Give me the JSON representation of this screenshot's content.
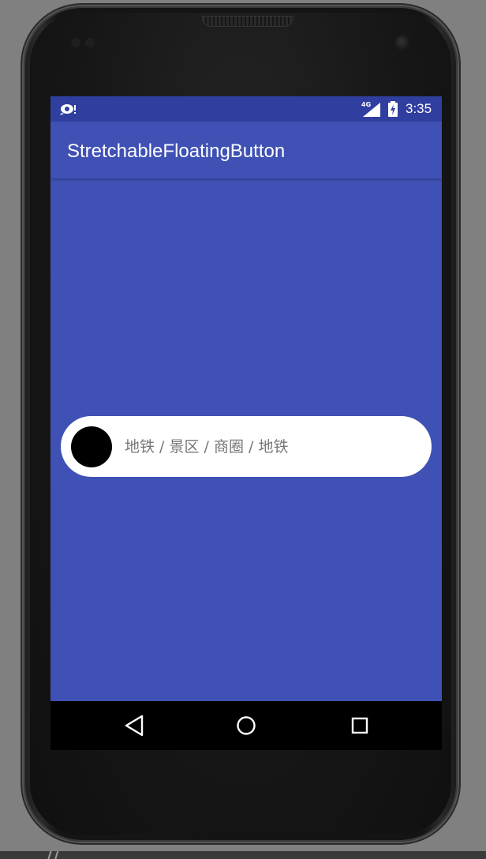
{
  "status_bar": {
    "network": "4G",
    "time": "3:35",
    "icons": [
      "notification-icon",
      "signal-icon",
      "battery-charging-icon"
    ]
  },
  "app_bar": {
    "title": "StretchableFloatingButton"
  },
  "floating_button": {
    "label": "地铁 / 景区 / 商圈 / 地铁"
  },
  "nav_bar": {
    "icons": [
      "back-icon",
      "home-icon",
      "recents-icon"
    ]
  },
  "bottom_strip": {
    "partial_text": "//"
  },
  "colors": {
    "primary": "#3f51b5",
    "primary_dark": "#303f9f",
    "surface": "#ffffff",
    "knob": "#000000",
    "label_text": "#777777"
  }
}
